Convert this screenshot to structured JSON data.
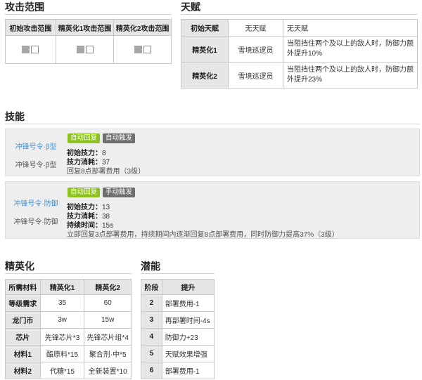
{
  "attack_range": {
    "title": "攻击范围",
    "headers": [
      "初始攻击范围",
      "精英化1攻击范围",
      "精英化2攻击范围"
    ]
  },
  "talent": {
    "title": "天赋",
    "rows": [
      {
        "label": "初始天赋",
        "name": "无天赋",
        "desc": [
          "无天赋"
        ]
      },
      {
        "label": "精英化1",
        "name": "雪境巡逻员",
        "desc": [
          "当阻挡住两个及以上的敌人时，防御力额",
          "外提升10%"
        ]
      },
      {
        "label": "精英化2",
        "name": "雪境巡逻员",
        "desc": [
          "当阻挡住两个及以上的敌人时，防御力额",
          "外提升23%"
        ]
      }
    ]
  },
  "skills": {
    "title": "技能",
    "items": [
      {
        "link": "冲锋号令·β型",
        "sub": "冲锋号令·β型",
        "tag1": "自动回复",
        "tag2": "自动触发",
        "stats": [
          {
            "label": "初始技力：",
            "value": "8"
          },
          {
            "label": "技力消耗：",
            "value": "37"
          }
        ],
        "desc": "回复8点部署费用（3级）"
      },
      {
        "link": "冲锋号令·防御",
        "sub": "冲锋号令·防御",
        "tag1": "自动回复",
        "tag2": "手动触发",
        "stats": [
          {
            "label": "初始技力：",
            "value": "13"
          },
          {
            "label": "技力消耗：",
            "value": "38"
          },
          {
            "label": "持续时间：",
            "value": "15s"
          }
        ],
        "desc": "立即回复3点部署费用，持续期间内逐渐回复8点部署费用，同时防御力提高37%（3级）"
      }
    ]
  },
  "elite": {
    "title": "精英化",
    "headers": [
      "所需材料",
      "精英化1",
      "精英化2"
    ],
    "rows": [
      [
        "等级需求",
        "35",
        "60"
      ],
      [
        "龙门币",
        "3w",
        "15w"
      ],
      [
        "芯片",
        "先锋芯片*3",
        "先锋芯片组*4"
      ],
      [
        "材料1",
        "酯原料*15",
        "聚合剂·中*5"
      ],
      [
        "材料2",
        "代糖*15",
        "全新装置*10"
      ]
    ]
  },
  "potential": {
    "title": "潜能",
    "headers": [
      "阶段",
      "提升"
    ],
    "rows": [
      [
        "2",
        "部署费用-1"
      ],
      [
        "3",
        "再部署时间-4s"
      ],
      [
        "4",
        "防御力+23"
      ],
      [
        "5",
        "天赋效果增强"
      ],
      [
        "6",
        "部署费用-1"
      ]
    ]
  }
}
